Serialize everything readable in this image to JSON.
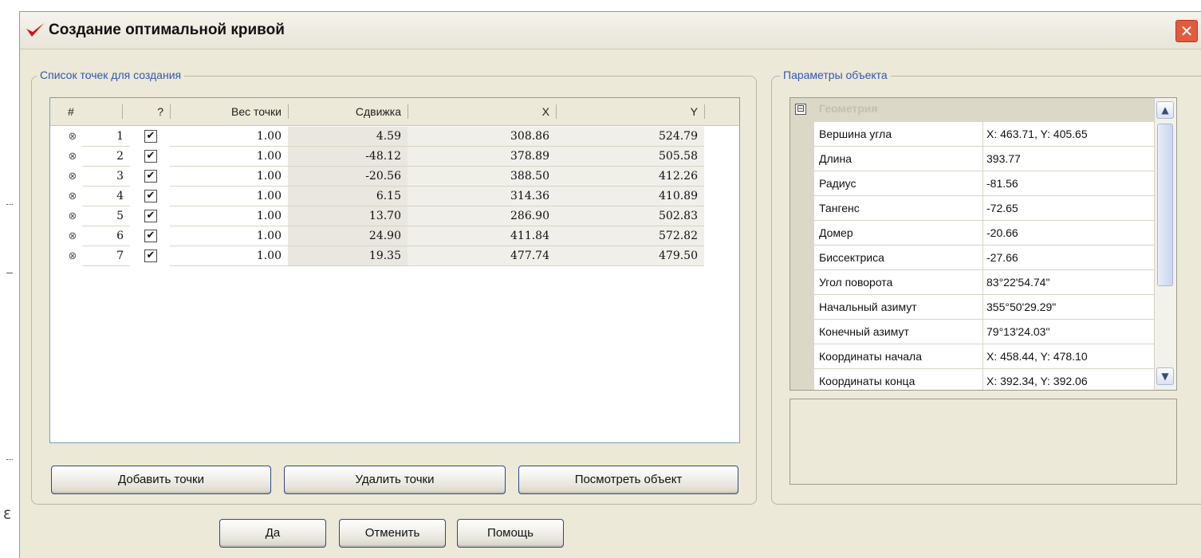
{
  "window": {
    "title": "Создание оптимальной кривой",
    "close_glyph": "✕",
    "close_color": "#e35b3c",
    "icon": "checkmark-logo-icon"
  },
  "points_group": {
    "legend": "Список точек для создания",
    "columns": [
      "#",
      "?",
      "Вес точки",
      "Сдвижка",
      "X",
      "Y"
    ],
    "rows": [
      {
        "num": "1",
        "checked": "✔",
        "weight": "1.00",
        "shift": "4.59",
        "x": "308.86",
        "y": "524.79"
      },
      {
        "num": "2",
        "checked": "✔",
        "weight": "1.00",
        "shift": "-48.12",
        "x": "378.89",
        "y": "505.58"
      },
      {
        "num": "3",
        "checked": "✔",
        "weight": "1.00",
        "shift": "-20.56",
        "x": "388.50",
        "y": "412.26"
      },
      {
        "num": "4",
        "checked": "✔",
        "weight": "1.00",
        "shift": "6.15",
        "x": "314.36",
        "y": "410.89"
      },
      {
        "num": "5",
        "checked": "✔",
        "weight": "1.00",
        "shift": "13.70",
        "x": "286.90",
        "y": "502.83"
      },
      {
        "num": "6",
        "checked": "✔",
        "weight": "1.00",
        "shift": "24.90",
        "x": "411.84",
        "y": "572.82"
      },
      {
        "num": "7",
        "checked": "✔",
        "weight": "1.00",
        "shift": "19.35",
        "x": "477.74",
        "y": "479.50"
      }
    ],
    "buttons": {
      "add": "Добавить точки",
      "remove": "Удалить точки",
      "view": "Посмотреть объект"
    }
  },
  "props_group": {
    "legend": "Параметры объекта",
    "category": {
      "toggle": "⊟",
      "label": "Геометрия"
    },
    "rows": [
      {
        "name": "Вершина угла",
        "value": "X: 463.71, Y: 405.65"
      },
      {
        "name": "Длина",
        "value": "393.77"
      },
      {
        "name": "Радиус",
        "value": "-81.56"
      },
      {
        "name": "Тангенс",
        "value": "-72.65"
      },
      {
        "name": "Домер",
        "value": "-20.66"
      },
      {
        "name": "Биссектриса",
        "value": "-27.66"
      },
      {
        "name": "Угол поворота",
        "value": "83°22'54.74\""
      },
      {
        "name": "Начальный азимут",
        "value": "355°50'29.29\""
      },
      {
        "name": "Конечный азимут",
        "value": "79°13'24.03\""
      },
      {
        "name": "Координаты начала",
        "value": "X: 458.44, Y: 478.10"
      },
      {
        "name": "Координаты конца",
        "value": "X: 392.34, Y: 392.06"
      }
    ],
    "scroll_up": "▲",
    "scroll_down": "▼"
  },
  "dialog_buttons": {
    "ok": "Да",
    "cancel": "Отменить",
    "help": "Помощь"
  },
  "icons": {
    "row_marker": "⊗"
  },
  "left_edge": {
    "glyph": "Ɛ"
  }
}
